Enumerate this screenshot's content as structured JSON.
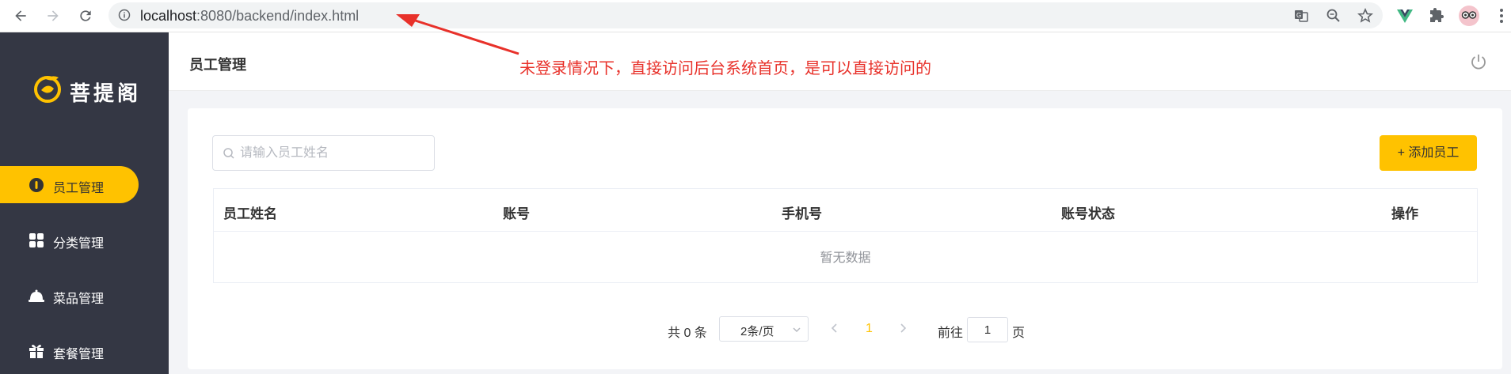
{
  "browser": {
    "url_host": "localhost",
    "url_rest": ":8080/backend/index.html"
  },
  "sidebar": {
    "logo_text": "菩提阁",
    "items": [
      {
        "label": "员工管理",
        "active": true,
        "icon": "user-badge-icon"
      },
      {
        "label": "分类管理",
        "active": false,
        "icon": "grid-icon"
      },
      {
        "label": "菜品管理",
        "active": false,
        "icon": "dish-icon"
      },
      {
        "label": "套餐管理",
        "active": false,
        "icon": "gift-icon"
      }
    ]
  },
  "header": {
    "title": "员工管理"
  },
  "annotation": {
    "text": "未登录情况下，直接访问后台系统首页，是可以直接访问的"
  },
  "toolbar": {
    "search_placeholder": "请输入员工姓名",
    "add_button_label": "+ 添加员工"
  },
  "table": {
    "columns": [
      "员工姓名",
      "账号",
      "手机号",
      "账号状态",
      "操作"
    ],
    "rows": [],
    "empty_text": "暂无数据"
  },
  "pagination": {
    "total_label": "共 0 条",
    "page_size": "2条/页",
    "current_page": "1",
    "goto_label": "前往",
    "goto_value": "1",
    "page_suffix": "页"
  },
  "colors": {
    "accent": "#ffc200",
    "sidebar_bg": "#343744",
    "annotation": "#e8312a"
  }
}
